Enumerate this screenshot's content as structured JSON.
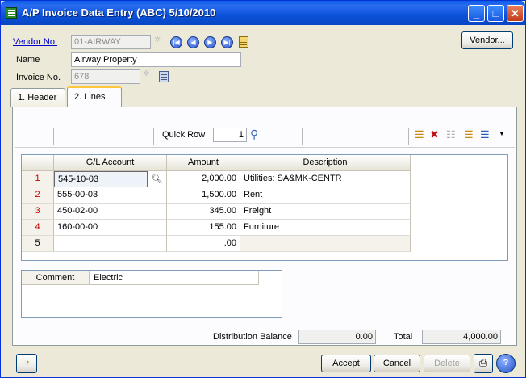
{
  "window": {
    "title": "A/P Invoice Data Entry (ABC) 5/10/2010"
  },
  "header": {
    "vendor_no_label": "Vendor No.",
    "vendor_no_value": "01-AIRWAY",
    "name_label": "Name",
    "name_value": "Airway Property",
    "invoice_no_label": "Invoice No.",
    "invoice_no_value": "678",
    "vendor_button": "Vendor..."
  },
  "tabs": [
    {
      "label": "1. Header"
    },
    {
      "label": "2. Lines"
    }
  ],
  "toolbar": {
    "quick_row_label": "Quick Row",
    "quick_row_value": "1"
  },
  "grid": {
    "columns": [
      "G/L Account",
      "Amount",
      "Description"
    ],
    "rows": [
      {
        "num": "1",
        "account": "545-10-03",
        "amount": "2,000.00",
        "description": "Utilities: SA&MK-CENTR"
      },
      {
        "num": "2",
        "account": "555-00-03",
        "amount": "1,500.00",
        "description": "Rent"
      },
      {
        "num": "3",
        "account": "450-02-00",
        "amount": "345.00",
        "description": "Freight"
      },
      {
        "num": "4",
        "account": "160-00-00",
        "amount": "155.00",
        "description": "Furniture"
      },
      {
        "num": "5",
        "account": "",
        "amount": ".00",
        "description": ""
      }
    ]
  },
  "comment": {
    "label": "Comment",
    "value": "Electric"
  },
  "totals": {
    "distribution_balance_label": "Distribution Balance",
    "distribution_balance_value": "0.00",
    "total_label": "Total",
    "total_value": "4,000.00"
  },
  "footer": {
    "accept": "Accept",
    "cancel": "Cancel",
    "delete": "Delete"
  }
}
